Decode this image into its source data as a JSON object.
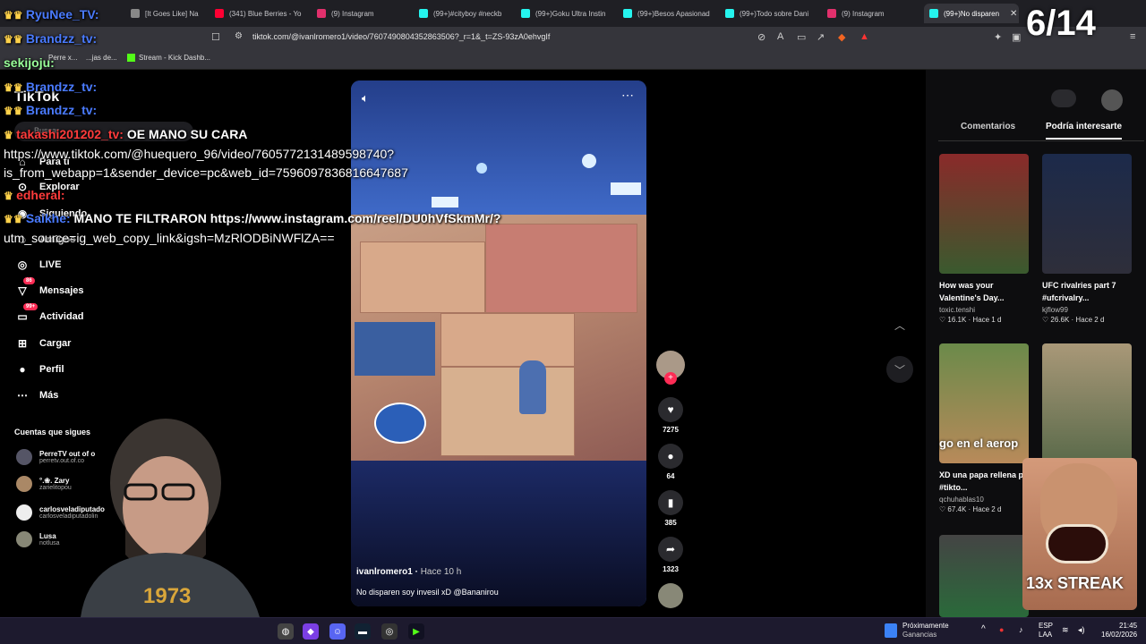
{
  "browser": {
    "tabs": [
      {
        "label": "[It Goes Like] Na",
        "color": "#888"
      },
      {
        "label": "(341) Blue Berries - Yo",
        "color": "#ff0033"
      },
      {
        "label": "(9) Instagram",
        "color": "#e1306c"
      },
      {
        "label": "(99+)#cityboy #neckb",
        "color": "#25f4ee"
      },
      {
        "label": "(99+)Goku Ultra Instin",
        "color": "#25f4ee"
      },
      {
        "label": "(99+)Besos Apasionad",
        "color": "#25f4ee"
      },
      {
        "label": "(99+)Todo sobre Dani",
        "color": "#25f4ee"
      },
      {
        "label": "(9) Instagram",
        "color": "#e1306c"
      },
      {
        "label": "(99+)No disparen",
        "color": "#25f4ee"
      }
    ],
    "url": "tiktok.com/@ivanlromero1/video/7607490804352863506?_r=1&_t=ZS-93zA0ehvgIf",
    "bookmarks": [
      {
        "label": "Perre x..."
      },
      {
        "label": "...jas de..."
      },
      {
        "label": "Stream - Kick Dashb..."
      }
    ]
  },
  "tiktok": {
    "logo": "TikTok",
    "search_placeholder": "Buscar",
    "nav": [
      {
        "label": "Para ti",
        "icon": "home-icon"
      },
      {
        "label": "Explorar",
        "icon": "compass-icon"
      },
      {
        "label": "Siguiendo",
        "icon": "users-icon"
      },
      {
        "label": "Amigos",
        "icon": "friends-icon"
      },
      {
        "label": "LIVE",
        "icon": "live-icon"
      },
      {
        "label": "Mensajes",
        "icon": "message-icon",
        "badge": "86"
      },
      {
        "label": "Actividad",
        "icon": "bell-icon",
        "badge": "99+"
      },
      {
        "label": "Cargar",
        "icon": "upload-icon"
      },
      {
        "label": "Perfil",
        "icon": "profile-icon"
      },
      {
        "label": "Más",
        "icon": "more-icon"
      }
    ],
    "following_title": "Cuentas que sigues",
    "following": [
      {
        "name": "PerreTV out of o",
        "handle": "perretv.out.of.co"
      },
      {
        "name": "°.❀. Zary",
        "handle": "zarielitopou"
      },
      {
        "name": "carlosveladiputado",
        "handle": "carlosveladiputadolin"
      },
      {
        "name": "Lusa",
        "handle": "notlusa"
      }
    ],
    "video": {
      "author": "ivanlromero1",
      "time": "Hace 10 h",
      "description": "No disparen soy invesil xD @Bananirou"
    },
    "actions": [
      {
        "icon": "heart-icon",
        "count": "7275"
      },
      {
        "icon": "comment-icon",
        "count": "64"
      },
      {
        "icon": "bookmark-icon",
        "count": "385"
      },
      {
        "icon": "share-icon",
        "count": "1323"
      }
    ],
    "right_tabs": [
      "Comentarios",
      "Podría interesarte"
    ],
    "recommendations": [
      {
        "title": "How was your Valentine's Day...",
        "author": "toxic.tenshi",
        "stats": "♡ 16.1K · Hace 1 d",
        "color": "#3a5a2e"
      },
      {
        "title": "UFC rivalries part 7 #ufcrivalry...",
        "author": "kjflow99",
        "stats": "♡ 26.6K · Hace 2 d",
        "color": "#1c2a4a"
      },
      {
        "title": "XD una papa rellena ps #tikto...",
        "author": "qchuhablas10",
        "stats": "♡ 67.4K · Hace 2 d",
        "color": "#6b8a4a"
      },
      {
        "title": "",
        "author": "",
        "stats": "",
        "color": "#a99878"
      }
    ],
    "overlay_texts": [
      "go en el aerop"
    ]
  },
  "stream_overlay": {
    "counter": "6/14",
    "chat": [
      {
        "user": "RyuNee_TV:",
        "text": "",
        "style": "user"
      },
      {
        "user": "Brandzz_tv:",
        "text": "",
        "style": "user"
      },
      {
        "user": "sekijoju:",
        "text": "",
        "style": "grn"
      },
      {
        "user": "Brandzz_tv:",
        "text": "",
        "style": "user"
      },
      {
        "user": "Brandzz_tv:",
        "text": "",
        "style": "user"
      },
      {
        "user": "takashi201202_tv:",
        "text": " OE MANO SU CARA",
        "style": "red"
      },
      {
        "user": "",
        "text": "https://www.tiktok.com/@huequero_96/video/7605772131489598740?",
        "style": "plain"
      },
      {
        "user": "",
        "text": "is_from_webapp=1&sender_device=pc&web_id=7596097836816647687",
        "style": "plain"
      },
      {
        "user": "edheral:",
        "text": "",
        "style": "red"
      },
      {
        "user": "Saikhe:",
        "text": " MANO TE FILTRARON https://www.instagram.com/reel/DU0hVfSkmMr/?",
        "style": "user"
      },
      {
        "user": "",
        "text": "utm_source=ig_web_copy_link&igsh=MzRlODBiNWFlZA==",
        "style": "plain"
      }
    ],
    "reaction_label": "13x STREAK"
  },
  "taskbar": {
    "weather_title": "Próximamente",
    "weather_sub": "Ganancias",
    "lang": "ESP",
    "lang_sub": "LAA",
    "time": "21:45",
    "date": "16/02/2026"
  }
}
